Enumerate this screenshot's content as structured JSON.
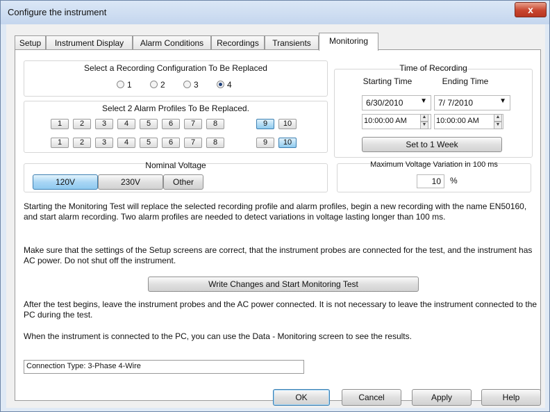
{
  "window": {
    "title": "Configure the instrument",
    "close_glyph": "x"
  },
  "tabs": [
    "Setup",
    "Instrument Display",
    "Alarm Conditions",
    "Recordings",
    "Transients",
    "Monitoring"
  ],
  "recording_config": {
    "label": "Select a Recording Configuration To Be Replaced",
    "options": [
      "1",
      "2",
      "3",
      "4"
    ],
    "selected": "4"
  },
  "alarm_profiles": {
    "label": "Select 2 Alarm Profiles To Be Replaced.",
    "row1": [
      "1",
      "2",
      "3",
      "4",
      "5",
      "6",
      "7",
      "8",
      "9",
      "10"
    ],
    "row2": [
      "1",
      "2",
      "3",
      "4",
      "5",
      "6",
      "7",
      "8",
      "9",
      "10"
    ],
    "row1_selected": "9",
    "row2_selected": "10"
  },
  "time_of_recording": {
    "label": "Time of Recording",
    "start_label": "Starting Time",
    "end_label": "Ending Time",
    "start_date": "6/30/2010",
    "end_date": "7/ 7/2010",
    "start_time": "10:00:00 AM",
    "end_time": "10:00:00 AM",
    "week_button": "Set to 1 Week"
  },
  "nominal_voltage": {
    "label": "Nominal Voltage",
    "options": [
      "120V",
      "230V",
      "Other"
    ],
    "selected": "120V"
  },
  "max_variation": {
    "label": "Maximum Voltage Variation in 100 ms",
    "value": "10",
    "unit": "%"
  },
  "info": {
    "p1": "Starting the Monitoring Test will replace the selected recording profile and alarm profiles, begin a new recording with the name EN50160, and start alarm recording. Two alarm profiles are needed to detect variations in voltage lasting longer than 100 ms.",
    "p2": "Make sure that the settings of the Setup screens are correct, that the instrument probes are connected for the test, and the instrument has AC power. Do not shut off the instrument.",
    "write_button": "Write Changes and Start Monitoring Test",
    "p3": "After the test begins, leave the instrument probes and the AC power connected. It is not necessary to leave the instrument connected to the PC during the test.",
    "p4": "When the instrument is connected to the PC, you can use the Data - Monitoring screen to see the results."
  },
  "connection": "Connection Type: 3-Phase 4-Wire",
  "footer": {
    "ok": "OK",
    "cancel": "Cancel",
    "apply": "Apply",
    "help": "Help"
  }
}
